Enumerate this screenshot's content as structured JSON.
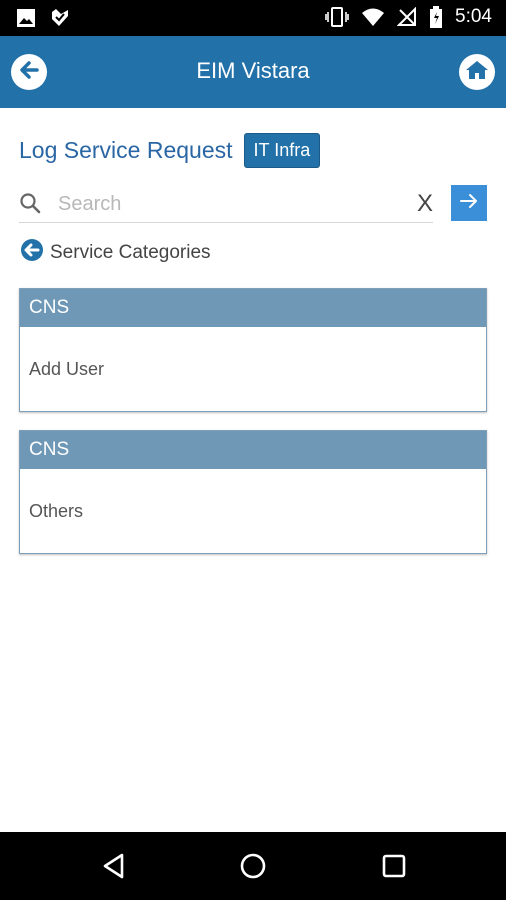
{
  "status_bar": {
    "time": "5:04",
    "icons": [
      "image-icon",
      "tag-icon",
      "vibrate-icon",
      "wifi-icon",
      "no-signal-icon",
      "battery-icon"
    ]
  },
  "app_bar": {
    "title": "EIM Vistara",
    "back_icon": "back-arrow-icon",
    "home_icon": "home-icon"
  },
  "heading": {
    "title": "Log Service Request",
    "badge": "IT Infra"
  },
  "search": {
    "placeholder": "Search",
    "value": "",
    "clear_label": "X",
    "go_icon": "arrow-right-icon"
  },
  "back_link": {
    "label": "Service Categories"
  },
  "cards": [
    {
      "header": "CNS",
      "body": "Add User"
    },
    {
      "header": "CNS",
      "body": "Others"
    }
  ],
  "colors": {
    "app_bar": "#2271a8",
    "title_text": "#2a66a4",
    "card_header": "#6f98b7",
    "go_button": "#3b8fd9"
  }
}
